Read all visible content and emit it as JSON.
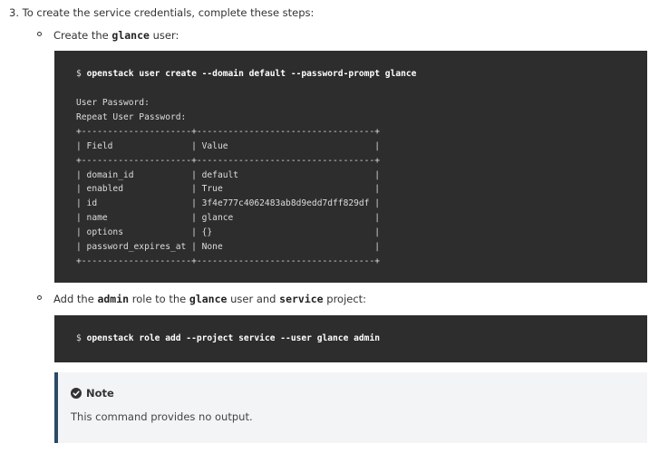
{
  "step": {
    "text": "3. To create the service credentials, complete these steps:"
  },
  "bullet1": {
    "prefix": "Create the ",
    "code": "glance",
    "suffix": " user:"
  },
  "code_block1": {
    "prompt": "$ ",
    "command": "openstack user create --domain default --password-prompt glance",
    "output": "User Password:\nRepeat User Password:\n+---------------------+----------------------------------+\n| Field               | Value                            |\n+---------------------+----------------------------------+\n| domain_id           | default                          |\n| enabled             | True                             |\n| id                  | 3f4e777c4062483ab8d9edd7dff829df |\n| name                | glance                           |\n| options             | {}                               |\n| password_expires_at | None                             |\n+---------------------+----------------------------------+"
  },
  "bullet2": {
    "part1": "Add the ",
    "code1": "admin",
    "part2": " role to the ",
    "code2": "glance",
    "part3": " user and ",
    "code3": "service",
    "part4": " project:"
  },
  "code_block2": {
    "prompt": "$ ",
    "command": "openstack role add --project service --user glance admin"
  },
  "note": {
    "icon": "check-circle-icon",
    "title": "Note",
    "body": "This command provides no output."
  },
  "colors": {
    "code_background": "#2d2d2d",
    "note_background": "#f3f4f6",
    "note_border": "#2b4a66"
  }
}
